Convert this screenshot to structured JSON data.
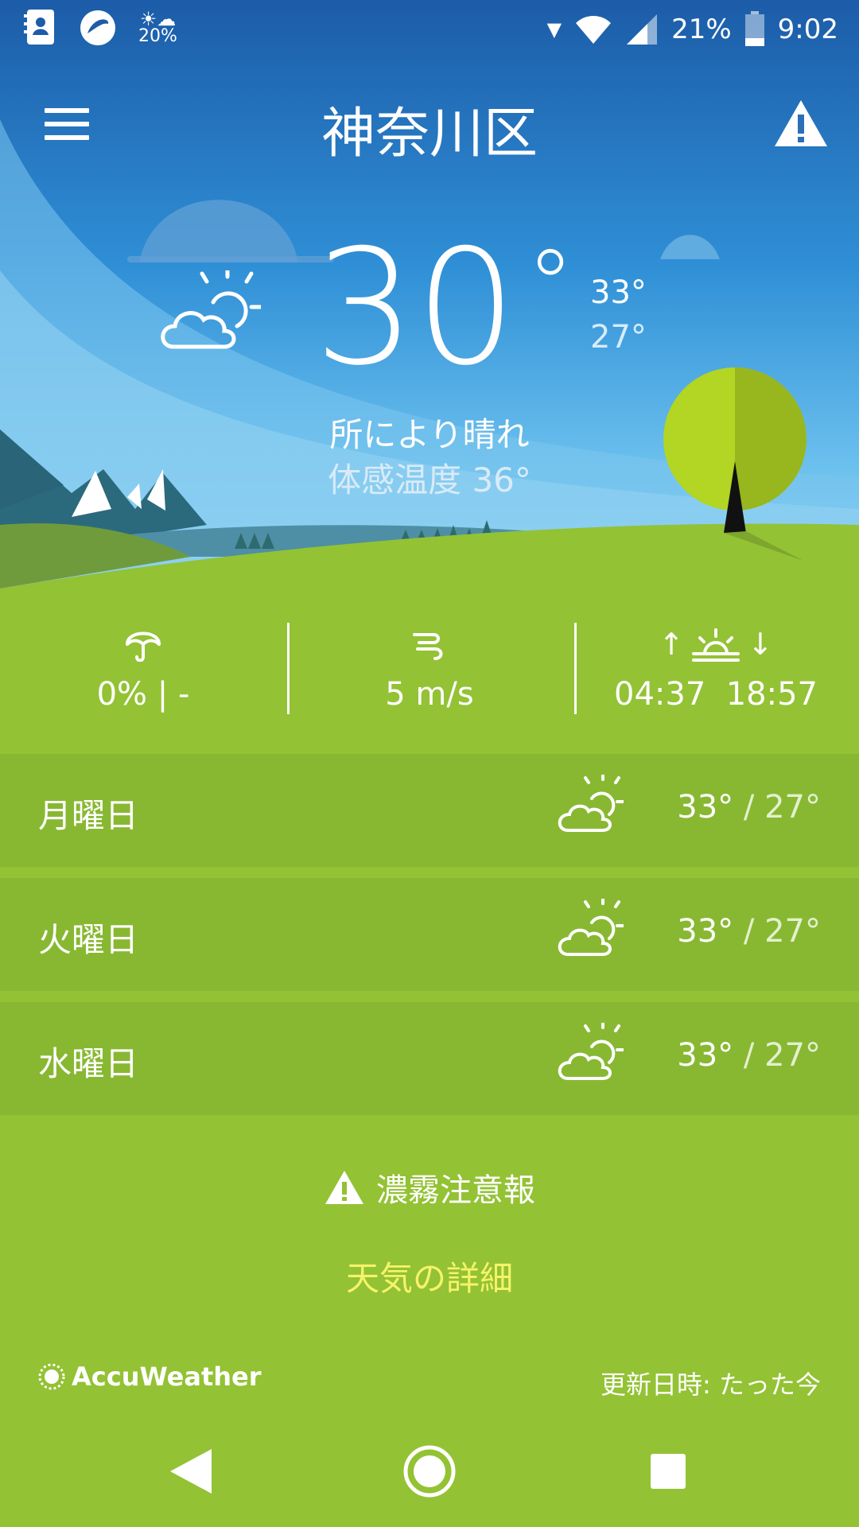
{
  "status_bar": {
    "weather_percent": "20%",
    "battery": "21%",
    "time": "9:02"
  },
  "header": {
    "title": "神奈川区"
  },
  "current": {
    "temp": "30",
    "degree_symbol": "°",
    "high": "33°",
    "low": "27°",
    "condition": "所により晴れ",
    "feels_like": "体感温度 36°"
  },
  "details": {
    "precip": "0% | -",
    "wind": "5 m/s",
    "sunrise": "04:37",
    "sunset": "18:57",
    "sunrise_arrow": "↑",
    "sunset_arrow": "↓"
  },
  "forecast": [
    {
      "day": "月曜日",
      "high": "33°",
      "sep": " / ",
      "low": "27°"
    },
    {
      "day": "火曜日",
      "high": "33°",
      "sep": " / ",
      "low": "27°"
    },
    {
      "day": "水曜日",
      "high": "33°",
      "sep": " / ",
      "low": "27°"
    }
  ],
  "warning": "濃霧注意報",
  "details_link": "天気の詳細",
  "brand": "AccuWeather",
  "updated": "更新日時: たった今",
  "icons": {
    "weather": "partly-sunny-icon",
    "umbrella": "umbrella-icon",
    "wind": "wind-icon",
    "sun": "sunrise-icon",
    "alert": "alert-triangle-icon"
  },
  "colors": {
    "grass": "#93c234",
    "forecast_row": "#88b832",
    "sky_top": "#2a6fb8",
    "link": "#f6f36a"
  }
}
